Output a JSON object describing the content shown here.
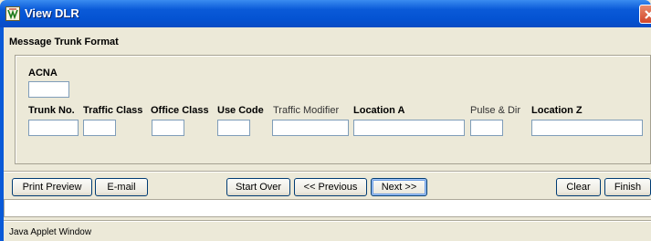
{
  "window": {
    "title": "View DLR"
  },
  "form": {
    "section_title": "Message Trunk Format",
    "acna": {
      "label": "ACNA",
      "value": ""
    },
    "fields": [
      {
        "label": "Trunk No.",
        "value": ""
      },
      {
        "label": "Traffic Class",
        "value": ""
      },
      {
        "label": "Office Class",
        "value": ""
      },
      {
        "label": "Use Code",
        "value": ""
      },
      {
        "label": "Traffic Modifier",
        "value": ""
      },
      {
        "label": "Location A",
        "value": ""
      },
      {
        "label": "Pulse & Dir",
        "value": ""
      },
      {
        "label": "Location Z",
        "value": ""
      }
    ]
  },
  "buttons": {
    "print_preview": "Print Preview",
    "email": "E-mail",
    "start_over": "Start Over",
    "previous": "<< Previous",
    "next": "Next >>",
    "clear": "Clear",
    "finish": "Finish"
  },
  "status": {
    "field_value": "",
    "applet_label": "Java Applet Window"
  },
  "colors": {
    "titlebar": "#0453d2",
    "window_bg": "#ece9d8",
    "close_button": "#d2462a",
    "field_border": "#7f9db9",
    "button_border": "#003c74"
  },
  "icons": [
    "app-icon",
    "close-icon"
  ]
}
